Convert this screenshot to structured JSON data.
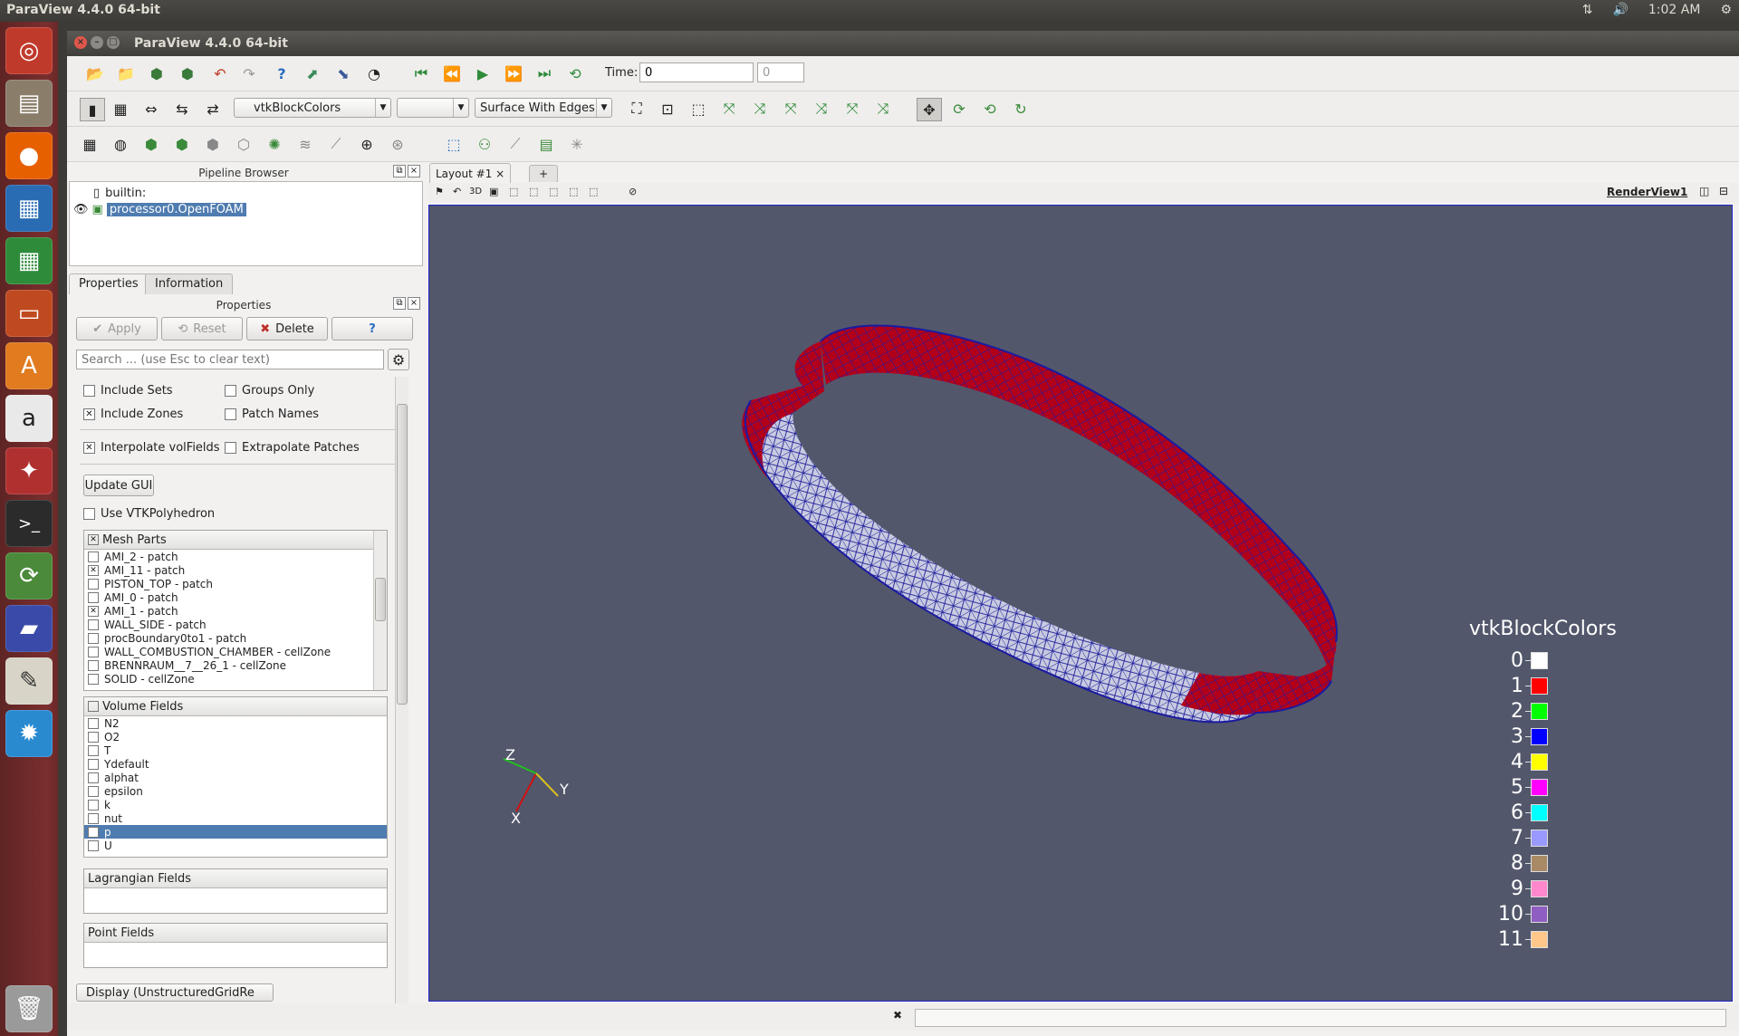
{
  "system_bar": {
    "app_title": "ParaView 4.4.0 64-bit",
    "clock": "1:02 AM"
  },
  "launcher": {
    "icons": [
      "ubuntu-icon",
      "files-icon",
      "firefox-icon",
      "writer-icon",
      "calc-icon",
      "impress-icon",
      "software-center-icon",
      "amazon-icon",
      "settings-icon",
      "terminal-icon",
      "updater-icon",
      "paraview-icon",
      "editor-icon",
      "app-icon",
      "trash-icon"
    ]
  },
  "window": {
    "title": "ParaView 4.4.0 64-bit"
  },
  "toolbar1": {
    "time_label": "Time:",
    "time_value": "0",
    "time_step": "0"
  },
  "toolbar2": {
    "color_by": "vtkBlockColors",
    "component": "",
    "representation": "Surface With Edges"
  },
  "pipeline_browser": {
    "title": "Pipeline Browser",
    "root": "builtin:",
    "source": "processor0.OpenFOAM"
  },
  "tabs": {
    "properties": "Properties",
    "information": "Information"
  },
  "properties": {
    "title": "Properties",
    "apply": "Apply",
    "reset": "Reset",
    "delete": "Delete",
    "help": "?",
    "search_placeholder": "Search ... (use Esc to clear text)",
    "include_sets": "Include Sets",
    "groups_only": "Groups Only",
    "include_zones": "Include Zones",
    "patch_names": "Patch Names",
    "interpolate_volfields": "Interpolate volFields",
    "extrapolate_patches": "Extrapolate Patches",
    "update_gui": "Update GUI",
    "use_vtkpolyhedron": "Use VTKPolyhedron",
    "mesh_parts_title": "Mesh Parts",
    "mesh_parts": [
      {
        "label": "AMI_2 - patch",
        "checked": false
      },
      {
        "label": "AMI_11 - patch",
        "checked": true
      },
      {
        "label": "PISTON_TOP - patch",
        "checked": false
      },
      {
        "label": "AMI_0 - patch",
        "checked": false
      },
      {
        "label": "AMI_1 - patch",
        "checked": true
      },
      {
        "label": "WALL_SIDE - patch",
        "checked": false
      },
      {
        "label": "procBoundary0to1 - patch",
        "checked": false
      },
      {
        "label": "WALL_COMBUSTION_CHAMBER - cellZone",
        "checked": false
      },
      {
        "label": "BRENNRAUM__7__26_1 - cellZone",
        "checked": false
      },
      {
        "label": "SOLID - cellZone",
        "checked": false
      }
    ],
    "volume_fields_title": "Volume Fields",
    "volume_fields": [
      "N2",
      "O2",
      "T",
      "Ydefault",
      "alphat",
      "epsilon",
      "k",
      "nut",
      "p",
      "U"
    ],
    "selected_volume_field": "p",
    "lagrangian_fields_title": "Lagrangian Fields",
    "point_fields_title": "Point Fields",
    "display_section": "Display (UnstructuredGridRe"
  },
  "layout": {
    "tab_label": "Layout #1",
    "add_tab": "+",
    "view_name": "RenderView1",
    "mode_3d": "3D"
  },
  "orientation_axes": {
    "x": "X",
    "y": "Y",
    "z": "Z"
  },
  "legend": {
    "title": "vtkBlockColors",
    "entries": [
      {
        "label": "0",
        "color": "#ffffff"
      },
      {
        "label": "1",
        "color": "#ff0000"
      },
      {
        "label": "2",
        "color": "#00ff00"
      },
      {
        "label": "3",
        "color": "#0000ff"
      },
      {
        "label": "4",
        "color": "#ffff00"
      },
      {
        "label": "5",
        "color": "#ff00ff"
      },
      {
        "label": "6",
        "color": "#00ffff"
      },
      {
        "label": "7",
        "color": "#9999ff"
      },
      {
        "label": "8",
        "color": "#a98a66"
      },
      {
        "label": "9",
        "color": "#ff88cc"
      },
      {
        "label": "10",
        "color": "#8e5ec2"
      },
      {
        "label": "11",
        "color": "#ffc88a"
      }
    ]
  },
  "colors": {
    "render_bg": "#52576b",
    "ring_red": "#b3001a",
    "mesh_edge": "#1a1aa0",
    "selection": "#4f7cb0"
  }
}
